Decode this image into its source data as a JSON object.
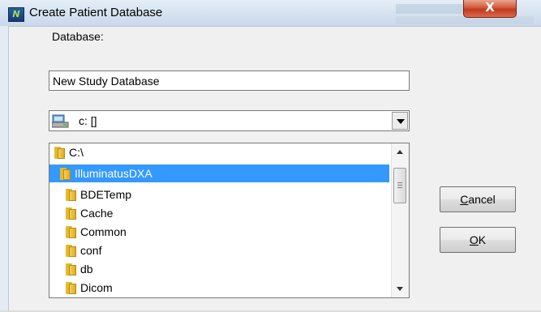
{
  "window": {
    "title": "Create Patient Database",
    "close_glyph": "X",
    "app_icon_glyph": "N"
  },
  "form": {
    "database_label": "Database:",
    "database_value": "New Study Database",
    "drive_value": "c: []"
  },
  "directory_list": {
    "items": [
      {
        "name": "C:\\",
        "selected": false,
        "indent": 0
      },
      {
        "name": "IlluminatusDXA",
        "selected": true,
        "indent": 1
      },
      {
        "name": "BDETemp",
        "selected": false,
        "indent": 2
      },
      {
        "name": "Cache",
        "selected": false,
        "indent": 2
      },
      {
        "name": "Common",
        "selected": false,
        "indent": 2
      },
      {
        "name": "conf",
        "selected": false,
        "indent": 2
      },
      {
        "name": "db",
        "selected": false,
        "indent": 2
      },
      {
        "name": "Dicom",
        "selected": false,
        "indent": 2
      }
    ]
  },
  "buttons": {
    "cancel_mnemonic": "C",
    "cancel_rest": "ancel",
    "ok_mnemonic": "O",
    "ok_rest": "K"
  },
  "colors": {
    "selection": "#3399ff",
    "close_button": "#c23a1e",
    "dialog_bg": "#f0f0f0"
  }
}
